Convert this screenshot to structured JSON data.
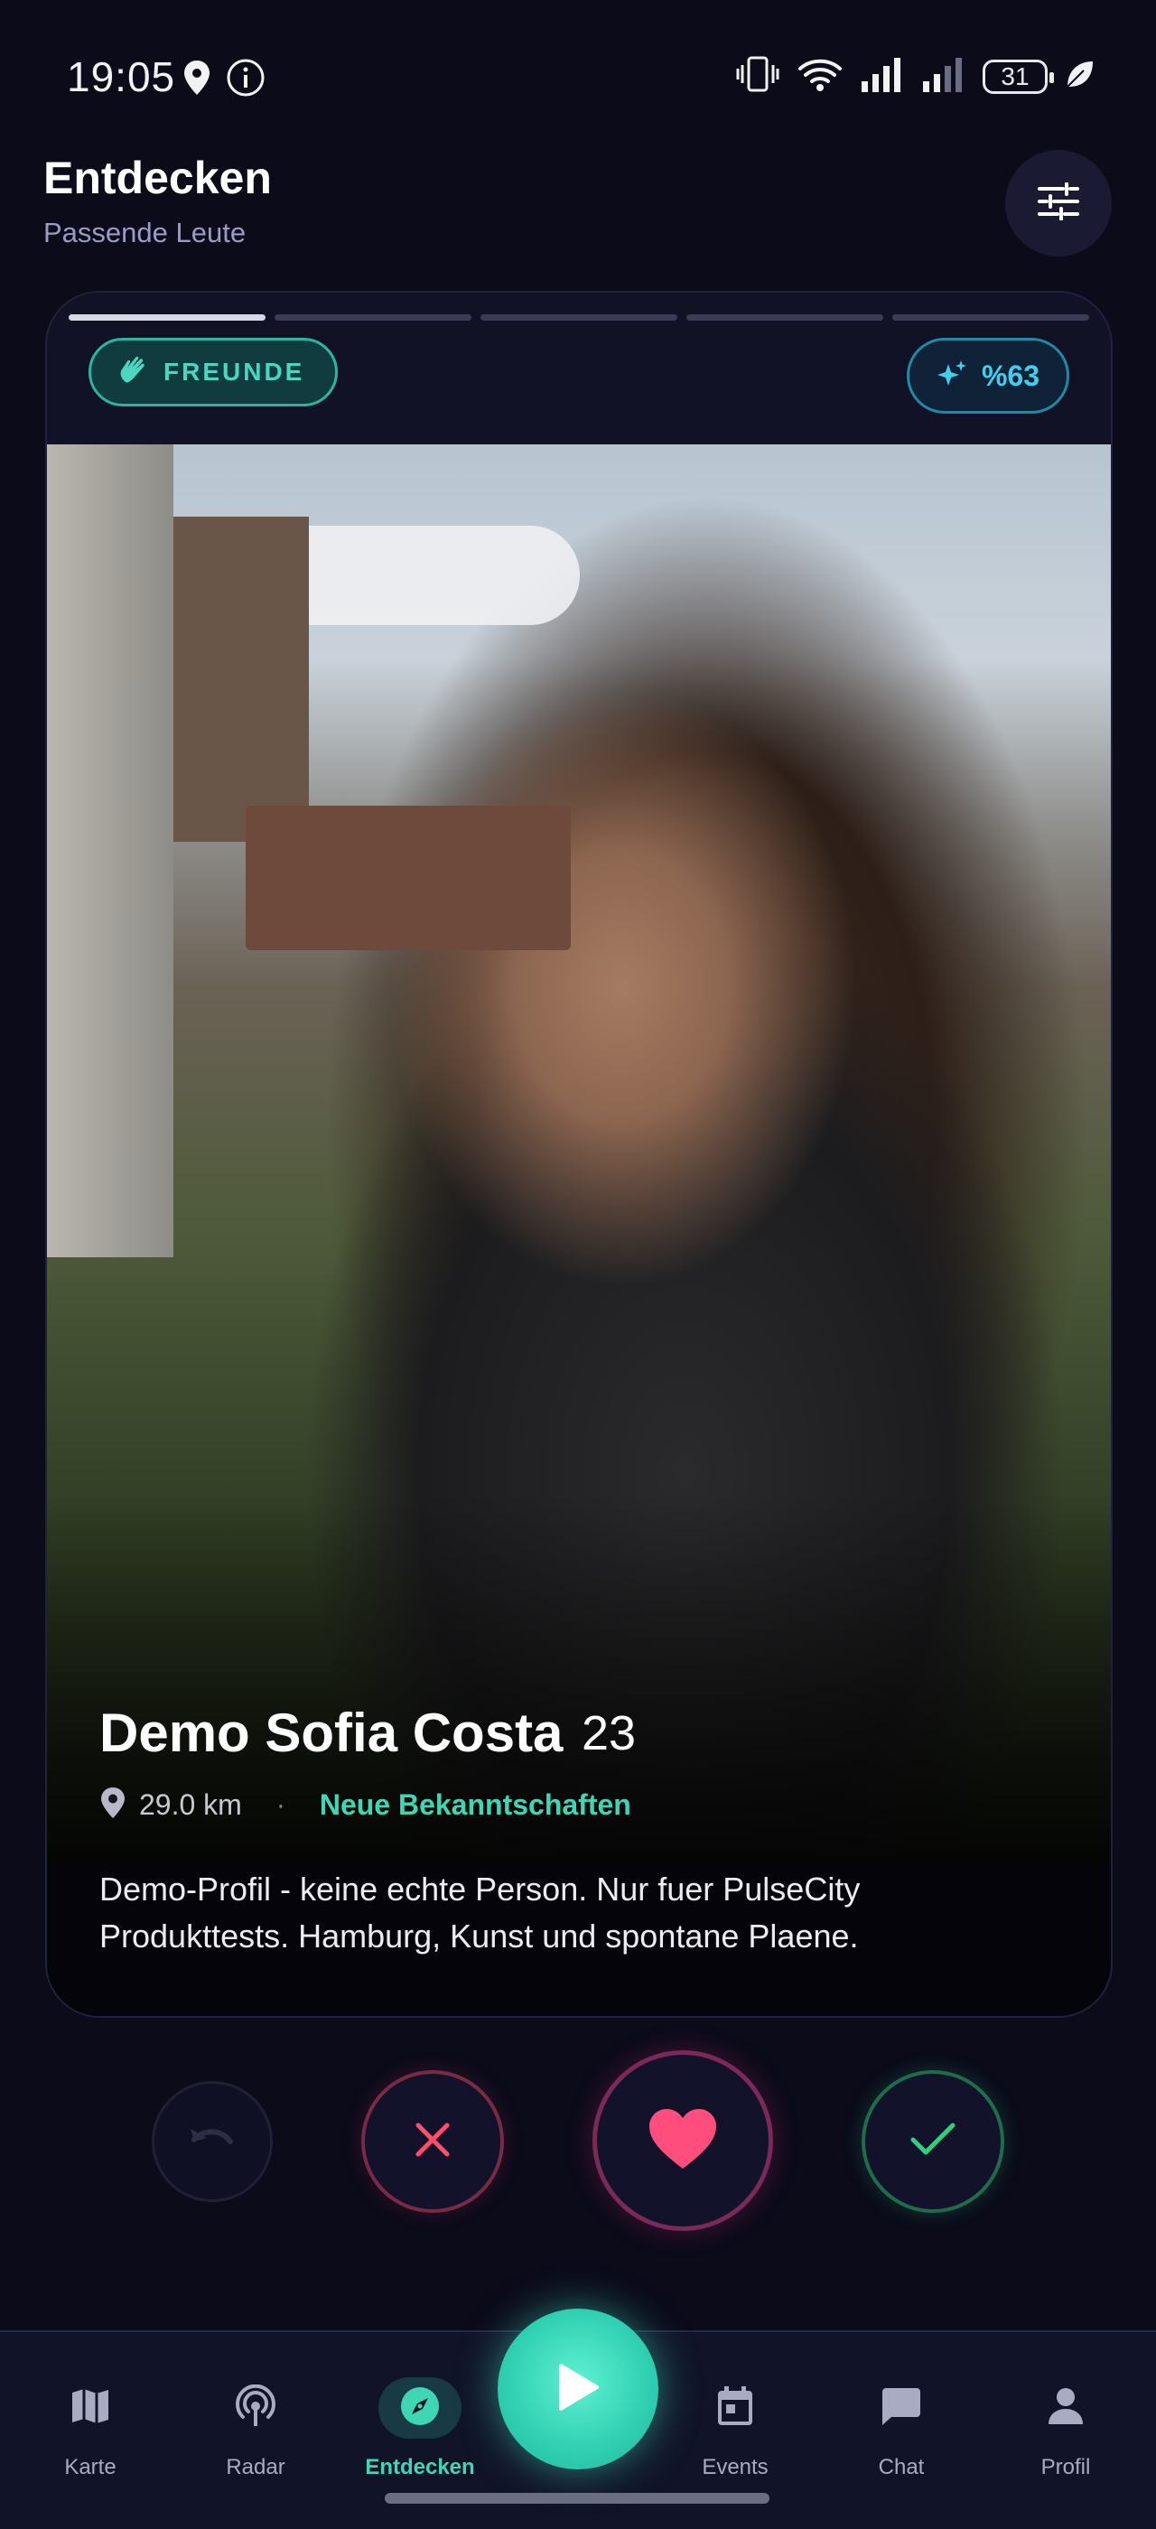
{
  "status_bar": {
    "time": "19:05",
    "battery": "31"
  },
  "header": {
    "title": "Entdecken",
    "subtitle": "Passende Leute",
    "filter_icon": "sliders-icon"
  },
  "card": {
    "photo_count": 5,
    "active_photo_index": 0,
    "mode_badge": "FREUNDE",
    "match_badge": "%63",
    "name": "Demo Sofia Costa",
    "age": "23",
    "distance": "29.0 km",
    "separator": "·",
    "category": "Neue Bekanntschaften",
    "bio": "Demo-Profil - keine echte Person. Nur fuer PulseCity Produkttests. Hamburg, Kunst und spontane Plaene."
  },
  "actions": {
    "undo_icon": "undo-icon",
    "reject_icon": "close-icon",
    "like_icon": "heart-icon",
    "accept_icon": "check-icon"
  },
  "nav": {
    "items": [
      {
        "label": "Karte",
        "icon": "map-icon"
      },
      {
        "label": "Radar",
        "icon": "radar-icon"
      },
      {
        "label": "Entdecken",
        "icon": "compass-icon"
      },
      {
        "label": "Events",
        "icon": "calendar-icon"
      },
      {
        "label": "Chat",
        "icon": "chat-icon"
      },
      {
        "label": "Profil",
        "icon": "person-icon"
      }
    ],
    "active": "Entdecken",
    "fab_icon": "play-icon"
  },
  "colors": {
    "background": "#0b0b1a",
    "accent": "#3fd6b6",
    "like": "#ff4d7d",
    "reject": "#ff4d6a",
    "accept": "#2fd07a"
  }
}
